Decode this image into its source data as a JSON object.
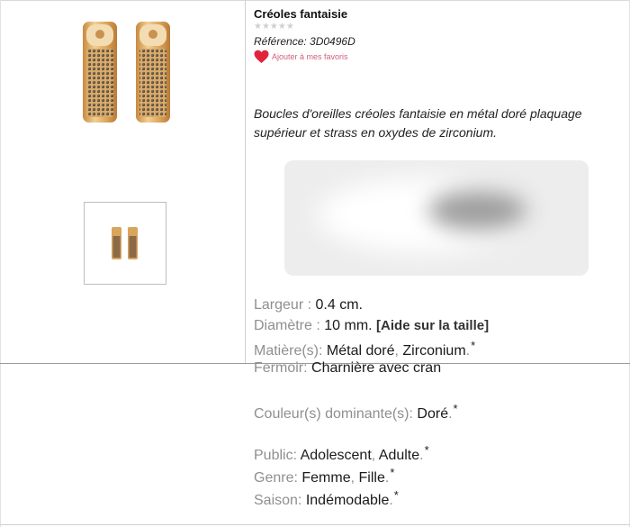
{
  "product": {
    "title": "Créoles fantaisie",
    "rating_stars": "★★★★★",
    "reference": "Référence: 3D0496D",
    "favorite_label": "Ajouter à mes favoris",
    "description": "Boucles d'oreilles créoles fantaisie en métal doré plaquage supérieur et strass en oxydes de zirconium."
  },
  "specs": {
    "largeur_label": "Largeur :",
    "largeur_value": "0.4 cm.",
    "diametre_label": "Diamètre :",
    "diametre_value": "10 mm.",
    "size_help": "[Aide sur la taille]",
    "matiere_label": "Matière(s):",
    "matiere_values": [
      "Métal doré",
      "Zirconium"
    ],
    "fermoir_label": "Fermoir:",
    "fermoir_value": "Charnière avec cran",
    "couleur_label": "Couleur(s) dominante(s):",
    "couleur_values": [
      "Doré"
    ],
    "public_label": "Public:",
    "public_values": [
      "Adolescent",
      "Adulte"
    ],
    "genre_label": "Genre:",
    "genre_values": [
      "Femme",
      "Fille"
    ],
    "saison_label": "Saison:",
    "saison_values": [
      "Indémodable"
    ],
    "comma": ",",
    "period": ".",
    "asterisk": "*"
  },
  "colors": {
    "label_gray": "#8f8f8f",
    "favorite_pink": "#d0607e",
    "heart_red": "#e0243c",
    "gold": "#d9a45c"
  },
  "icons": {
    "favorite": "heart-icon",
    "rating": "star-icon"
  }
}
